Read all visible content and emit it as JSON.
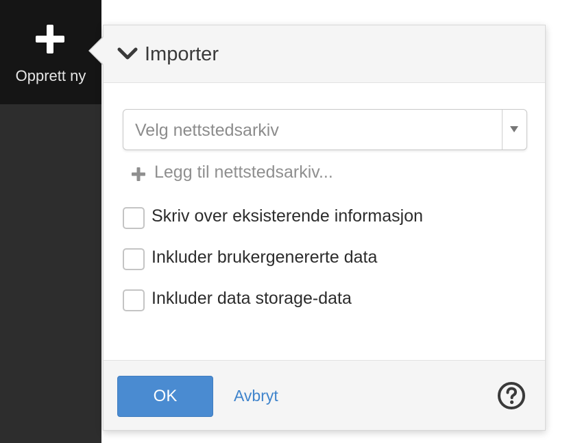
{
  "sidebar": {
    "create_new": {
      "icon": "plus-icon",
      "label": "Opprett ny"
    }
  },
  "dialog": {
    "header": {
      "icon": "chevron-down-icon",
      "title": "Importer"
    },
    "site_archive_select": {
      "placeholder": "Velg nettstedsarkiv",
      "selected_value": "",
      "icon": "caret-down-icon"
    },
    "add_archive": {
      "icon": "plus-icon",
      "label": "Legg til nettstedsarkiv..."
    },
    "options": [
      {
        "label": "Skriv over eksisterende informasjon",
        "checked": false
      },
      {
        "label": "Inkluder brukergenererte data",
        "checked": false
      },
      {
        "label": "Inkluder data storage-data",
        "checked": false
      }
    ],
    "footer": {
      "ok_label": "OK",
      "cancel_label": "Avbryt",
      "help_icon": "help-circle-icon"
    }
  },
  "colors": {
    "sidebar_bg": "#2d2d2d",
    "create_new_bg": "#151515",
    "primary_button": "#4a8bd1",
    "link": "#3f84cc",
    "panel_header_bg": "#f5f5f5"
  }
}
